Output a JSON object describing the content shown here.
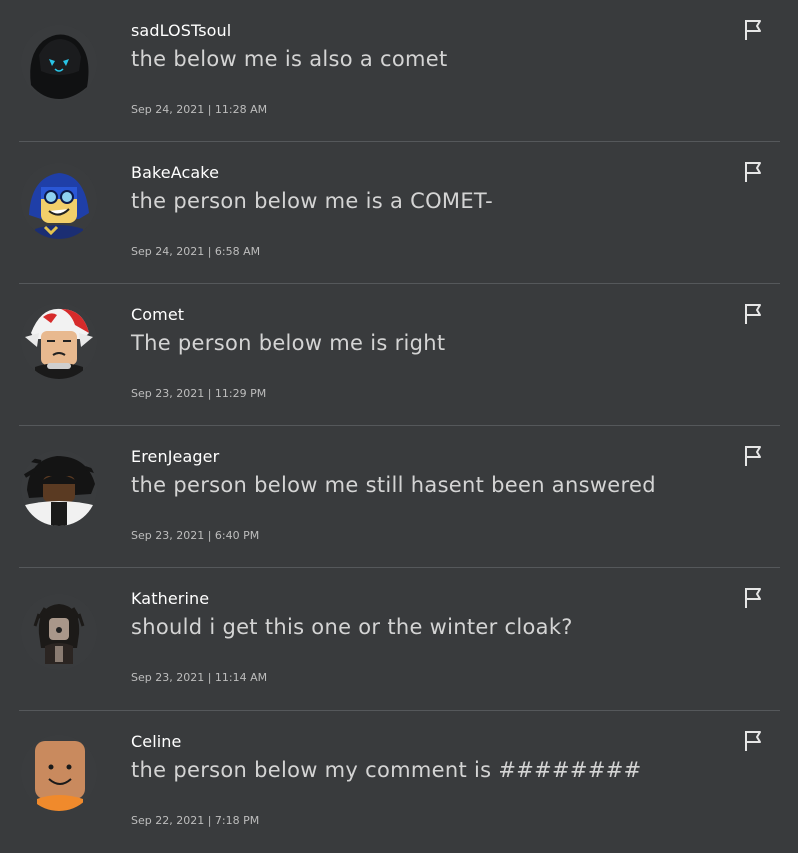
{
  "comments": [
    {
      "username": "sadLOSTsoul",
      "text": "the below me is also a comet",
      "time": "Sep 24, 2021 | 11:28 AM",
      "avatar_icon": "dark-hooded-avatar"
    },
    {
      "username": "BakeAcake",
      "text": "the person below me is a COMET-",
      "time": "Sep 24, 2021 | 6:58 AM",
      "avatar_icon": "blue-hair-goggles-avatar"
    },
    {
      "username": "Comet",
      "text": "The person below me is right",
      "time": "Sep 23, 2021 | 11:29 PM",
      "avatar_icon": "red-white-hair-avatar"
    },
    {
      "username": "ErenJeager",
      "text": "the person below me still hasent been answered",
      "time": "Sep 23, 2021 | 6:40 PM",
      "avatar_icon": "black-hair-avatar"
    },
    {
      "username": "Katherine",
      "text": "should i get this one or the winter cloak?",
      "time": "Sep 23, 2021 | 11:14 AM",
      "avatar_icon": "dark-dreads-avatar"
    },
    {
      "username": "Celine",
      "text": "the person below my comment is ########",
      "time": "Sep 22, 2021 | 7:18 PM",
      "avatar_icon": "classic-smile-avatar"
    }
  ],
  "report_icon": "flag-icon"
}
